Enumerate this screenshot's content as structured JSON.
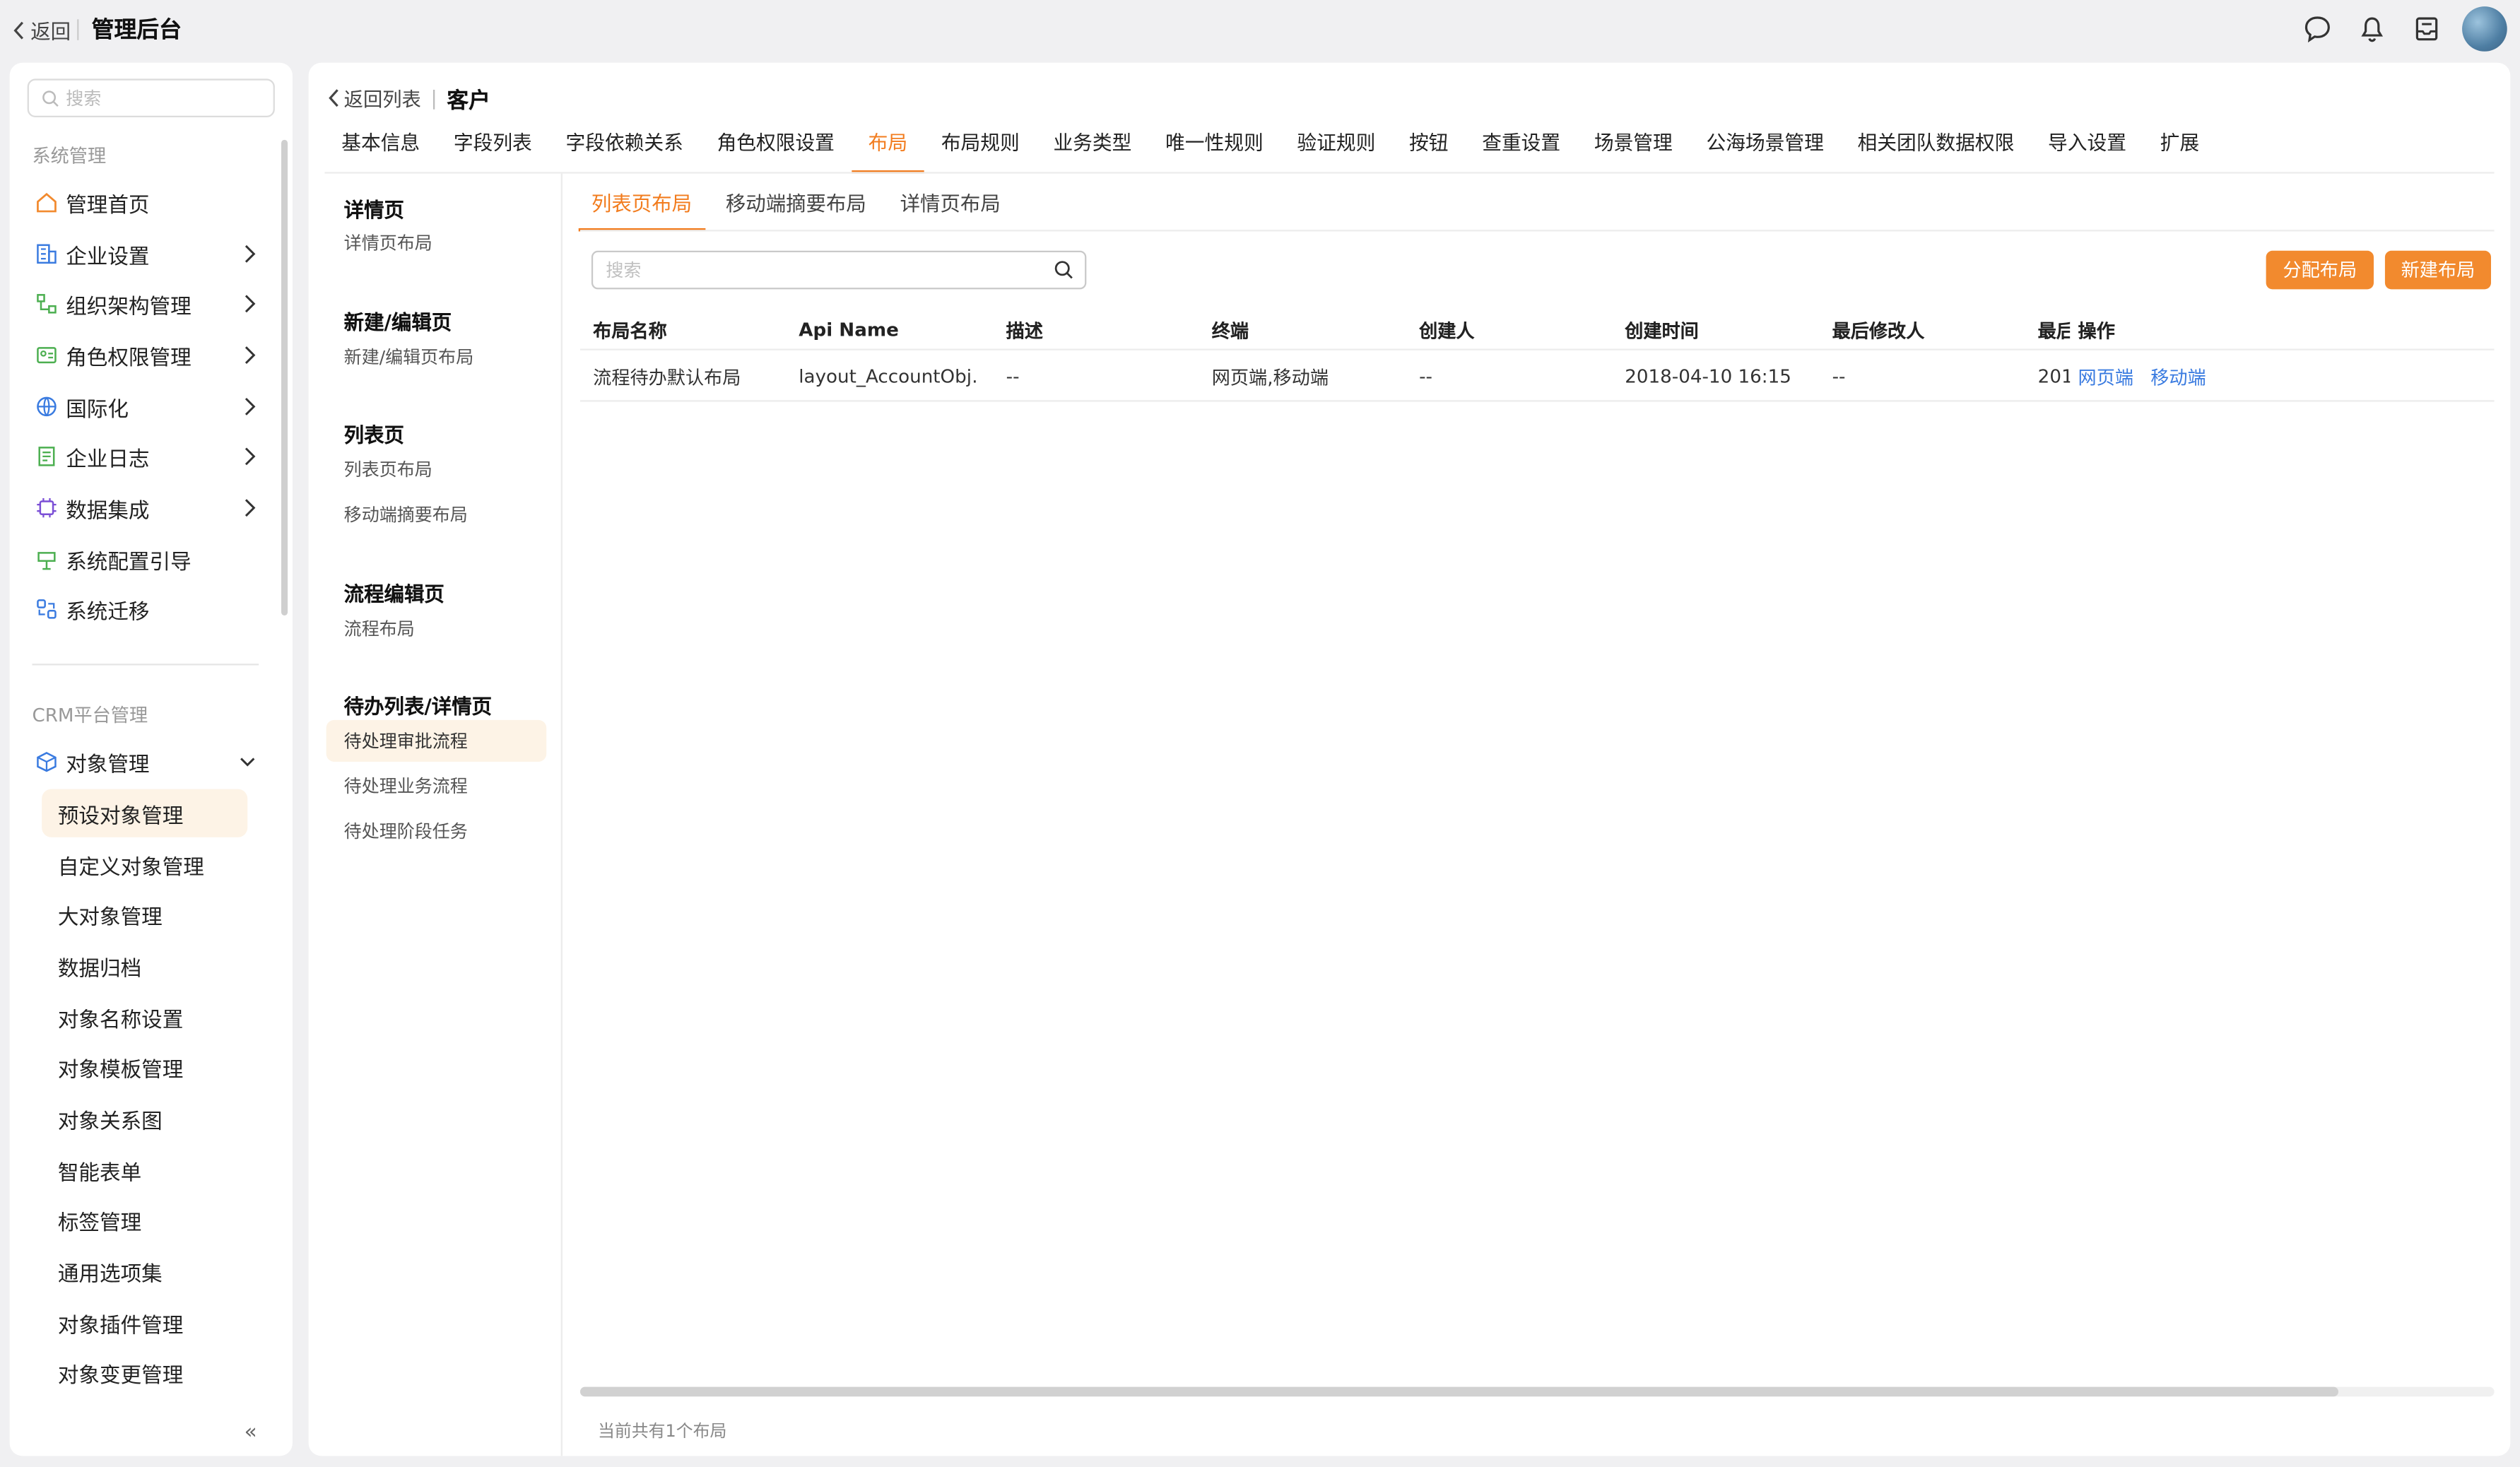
{
  "topbar": {
    "back_label": "返回",
    "app_title": "管理后台",
    "icons": [
      "chat-icon",
      "bell-icon",
      "inbox-icon",
      "avatar"
    ]
  },
  "sidebar": {
    "search_placeholder": "搜索",
    "section1": "系统管理",
    "items": [
      {
        "label": "管理首页",
        "icon": "home-icon",
        "arrow": false
      },
      {
        "label": "企业设置",
        "icon": "building-icon",
        "arrow": true
      },
      {
        "label": "组织架构管理",
        "icon": "org-icon",
        "arrow": true
      },
      {
        "label": "角色权限管理",
        "icon": "role-icon",
        "arrow": true
      },
      {
        "label": "国际化",
        "icon": "globe-icon",
        "arrow": true
      },
      {
        "label": "企业日志",
        "icon": "log-icon",
        "arrow": true
      },
      {
        "label": "数据集成",
        "icon": "chip-icon",
        "arrow": true
      },
      {
        "label": "系统配置引导",
        "icon": "guide-icon",
        "arrow": false
      },
      {
        "label": "系统迁移",
        "icon": "migrate-icon",
        "arrow": false
      }
    ],
    "section2": "CRM平台管理",
    "object_mgmt": "对象管理",
    "subitems": [
      "预设对象管理",
      "自定义对象管理",
      "大对象管理",
      "数据归档",
      "对象名称设置",
      "对象模板管理",
      "对象关系图",
      "智能表单",
      "标签管理",
      "通用选项集",
      "对象插件管理",
      "对象变更管理"
    ],
    "collapse_label": "«"
  },
  "main": {
    "crumb_back": "返回列表",
    "object_name": "客户",
    "tabs": [
      "基本信息",
      "字段列表",
      "字段依赖关系",
      "角色权限设置",
      "布局",
      "布局规则",
      "业务类型",
      "唯一性规则",
      "验证规则",
      "按钮",
      "查重设置",
      "场景管理",
      "公海场景管理",
      "相关团队数据权限",
      "导入设置",
      "扩展"
    ],
    "active_tab": 4,
    "left_nav": {
      "groups": [
        {
          "title": "详情页",
          "links": [
            "详情页布局"
          ]
        },
        {
          "title": "新建/编辑页",
          "links": [
            "新建/编辑页布局"
          ]
        },
        {
          "title": "列表页",
          "links": [
            "列表页布局",
            "移动端摘要布局"
          ]
        },
        {
          "title": "流程编辑页",
          "links": [
            "流程布局"
          ]
        },
        {
          "title": "待办列表/详情页",
          "links": [
            "待处理审批流程",
            "待处理业务流程",
            "待处理阶段任务"
          ]
        }
      ]
    },
    "subtabs": [
      "列表页布局",
      "移动端摘要布局",
      "详情页布局"
    ],
    "search_placeholder": "搜索",
    "btn_assign": "分配布局",
    "btn_new": "新建布局",
    "table": {
      "headers": [
        "布局名称",
        "Api Name",
        "描述",
        "终端",
        "创建人",
        "创建时间",
        "最后修改人",
        "最后",
        "操作"
      ],
      "rows": [
        {
          "name": "流程待办默认布局",
          "api": "layout_AccountObj…",
          "desc": "--",
          "terminal": "网页端,移动端",
          "creator": "--",
          "created": "2018-04-10 16:15",
          "modifier": "--",
          "modified": "201",
          "ops": [
            "网页端",
            "移动端"
          ]
        }
      ]
    },
    "footer": "当前共有1个布局"
  },
  "colors": {
    "accent": "#f27c1e",
    "button": "#f28a2e",
    "link": "#3a7be0"
  }
}
